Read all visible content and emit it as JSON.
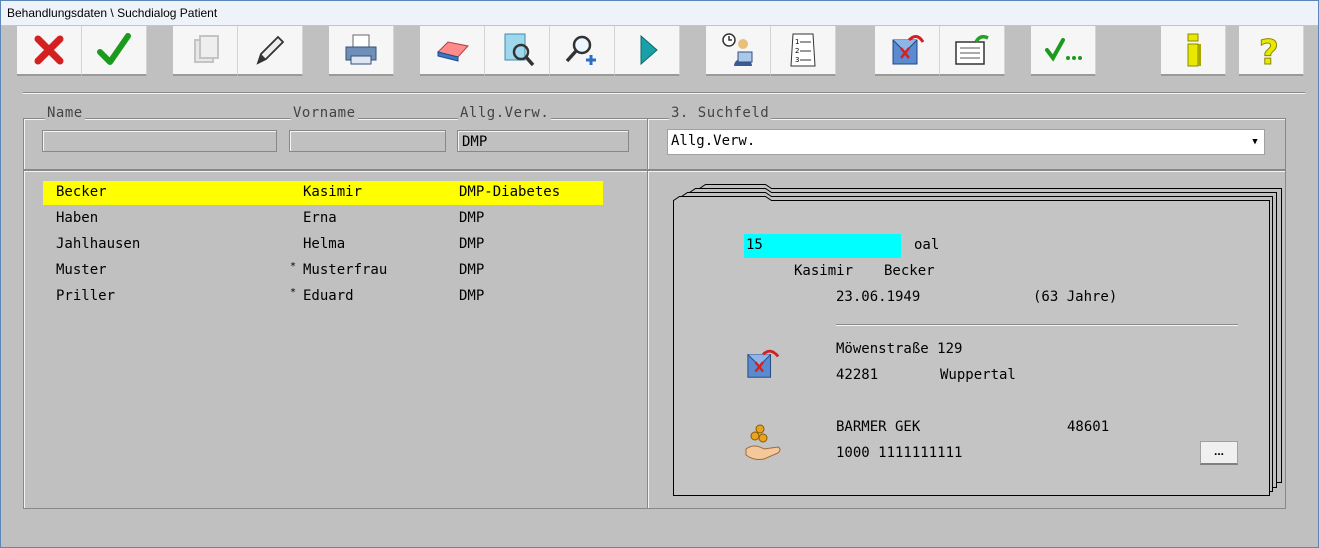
{
  "window": {
    "title": "Behandlungsdaten \\ Suchdialog Patient"
  },
  "search": {
    "name_label": "Name",
    "vorname_label": "Vorname",
    "allg_label": "Allg.Verw.",
    "feld3_label": "3. Suchfeld",
    "name_value": "",
    "vorname_value": "",
    "allg_value": "DMP",
    "feld3_value": "Allg.Verw."
  },
  "patients": [
    {
      "name": "Becker",
      "marker": "",
      "vorname": "Kasimir",
      "allg": "DMP-Diabetes",
      "selected": true
    },
    {
      "name": "Haben",
      "marker": "",
      "vorname": "Erna",
      "allg": "DMP",
      "selected": false
    },
    {
      "name": "Jahlhausen",
      "marker": "",
      "vorname": "Helma",
      "allg": "DMP",
      "selected": false
    },
    {
      "name": "Muster",
      "marker": "*",
      "vorname": "Musterfrau",
      "allg": "DMP",
      "selected": false
    },
    {
      "name": "Priller",
      "marker": "*",
      "vorname": "Eduard",
      "allg": "DMP",
      "selected": false
    }
  ],
  "detail": {
    "id": "15",
    "id_suffix": "oal",
    "vorname": "Kasimir",
    "name": "Becker",
    "birthdate": "23.06.1949",
    "age": "(63 Jahre)",
    "street": "Möwenstraße 129",
    "zip": "42281",
    "city": "Wuppertal",
    "insurance": "BARMER GEK",
    "insurance_code": "48601",
    "insurance_number": "1000 1111111111",
    "more_button": "..."
  },
  "colors": {
    "selection": "#ffff00",
    "id_highlight": "#00ffff",
    "background": "#c0c0c0"
  },
  "toolbar_icons": [
    "close-icon",
    "confirm-icon",
    "copy-icon",
    "edit-icon",
    "print-icon",
    "eraser-icon",
    "document-search-icon",
    "zoom-in-icon",
    "play-icon",
    "appointment-icon",
    "numbered-list-icon",
    "bdt-export-icon",
    "export-card-icon",
    "check-more-icon",
    "info-icon",
    "help-icon"
  ]
}
